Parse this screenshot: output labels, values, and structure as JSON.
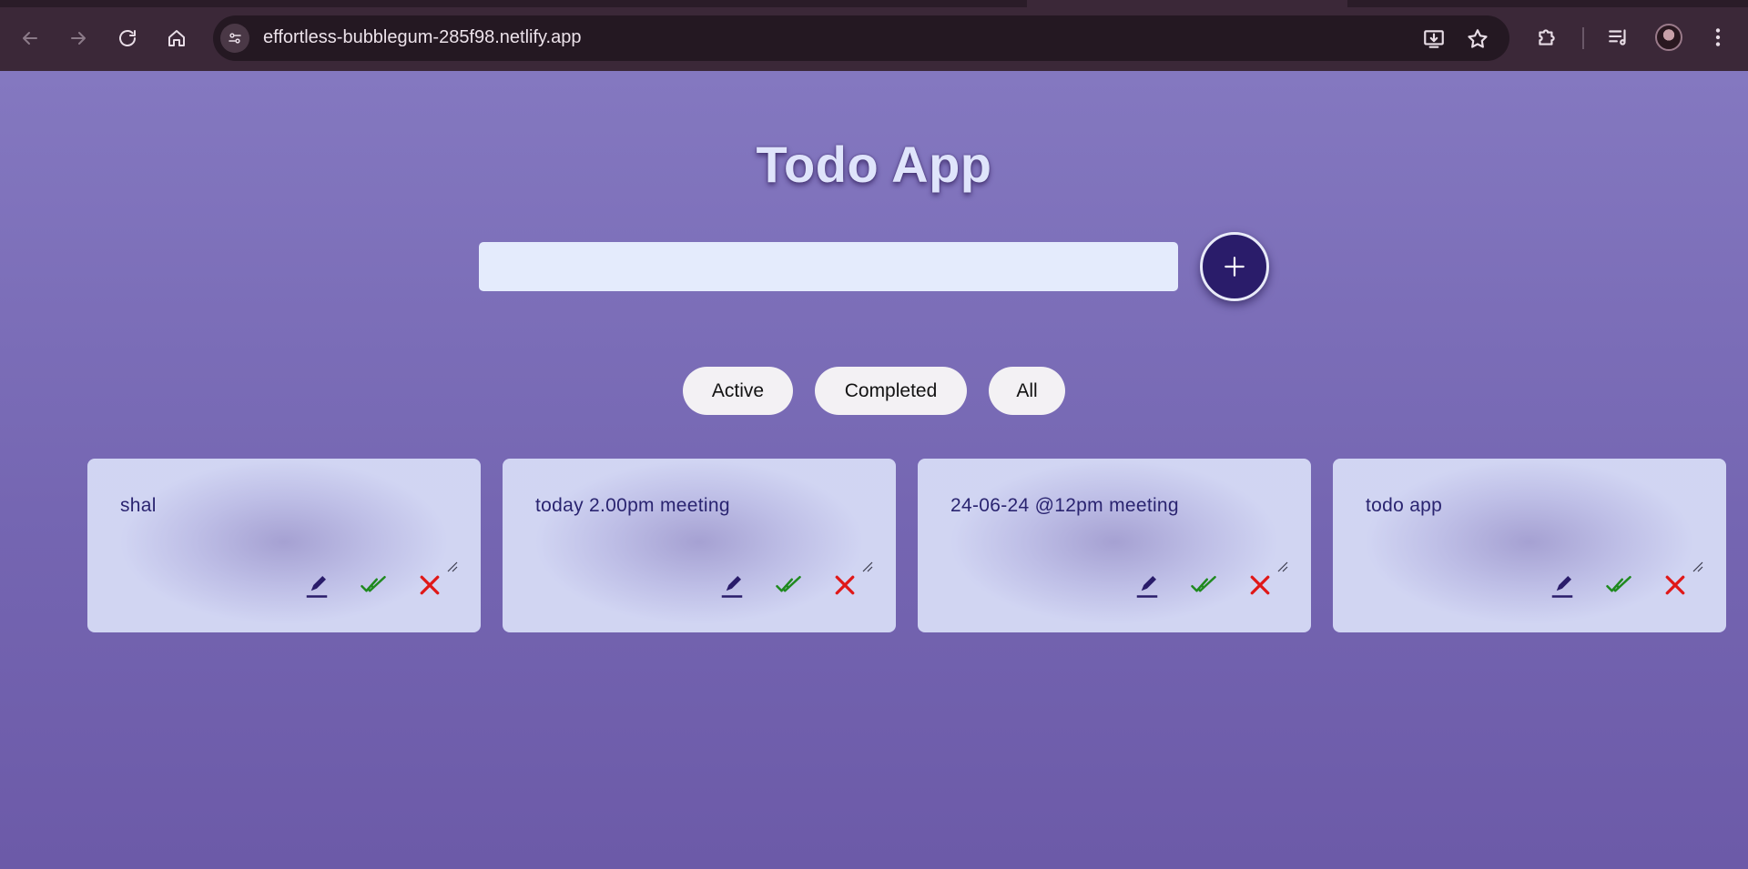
{
  "browser": {
    "url": "effortless-bubblegum-285f98.netlify.app",
    "icons": {
      "back": "arrow-left-icon",
      "forward": "arrow-right-icon",
      "reload": "reload-icon",
      "home": "home-icon",
      "site_info": "tune-icon",
      "install": "install-app-icon",
      "bookmark": "star-icon",
      "extensions": "puzzle-icon",
      "media": "media-queue-icon",
      "menu": "kebab-menu-icon"
    }
  },
  "app": {
    "title": "Todo App",
    "input": {
      "value": "",
      "placeholder": ""
    },
    "add_button_icon": "plus-icon",
    "filters": [
      {
        "label": "Active"
      },
      {
        "label": "Completed"
      },
      {
        "label": "All"
      }
    ],
    "todos": [
      {
        "text": "shal"
      },
      {
        "text": "today 2.00pm meeting"
      },
      {
        "text": "24-06-24 @12pm meeting"
      },
      {
        "text": "todo app"
      }
    ],
    "todo_actions": [
      "edit-icon",
      "check-icon",
      "delete-icon"
    ],
    "colors": {
      "accent": "#2a1c6a",
      "edit": "#2a1c6a",
      "complete": "#1f8a1f",
      "delete": "#e01818"
    }
  }
}
